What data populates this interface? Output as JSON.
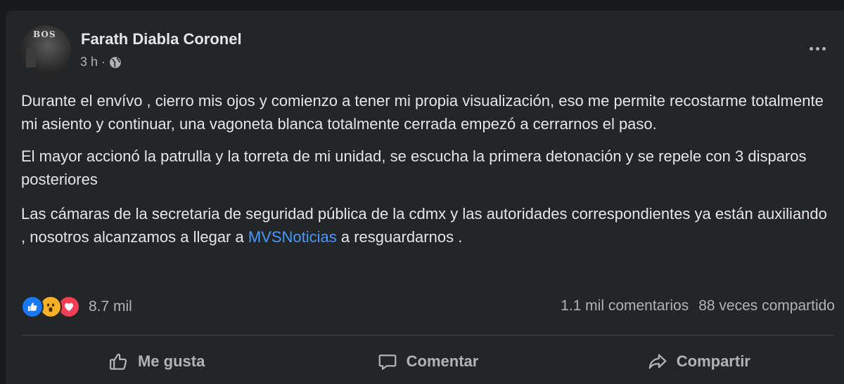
{
  "post": {
    "author": "Farath Diabla Coronel",
    "avatar_text": "BOS",
    "time": "3 h",
    "separator": "·",
    "privacy_icon": "globe-icon",
    "more_icon": "more-options-icon",
    "paragraphs": [
      "Durante el envívo , cierro mis ojos y comienzo a tener mi propia visualización, eso me permite recostarme totalmente mi asiento y continuar, una vagoneta blanca totalmente cerrada empezó a cerrarnos el paso.",
      "El mayor accionó la patrulla y la torreta de mi unidad, se escucha la primera detonación y se repele con 3 disparos posteriores"
    ],
    "paragraph3": {
      "before": "Las cámaras de la secretaria de seguridad pública de la cdmx y las autoridades correspondientes ya están auxiliando , nosotros alcanzamos a llegar a ",
      "link": "MVSNoticias",
      "after": " a resguardarnos ."
    }
  },
  "reactions": {
    "icons": [
      "like-reaction-icon",
      "wow-reaction-icon",
      "love-reaction-icon"
    ],
    "count": "8.7 mil"
  },
  "stats": {
    "comments": "1.1 mil comentarios",
    "shares": "88 veces compartido"
  },
  "actions": {
    "like": "Me gusta",
    "comment": "Comentar",
    "share": "Compartir"
  },
  "colors": {
    "background": "#18191a",
    "card": "#242526",
    "text_primary": "#e4e6eb",
    "text_secondary": "#b0b3b8",
    "link": "#4599ff",
    "like_blue": "#1877f2",
    "wow_yellow": "#f7b125",
    "love_red": "#f33e58"
  }
}
